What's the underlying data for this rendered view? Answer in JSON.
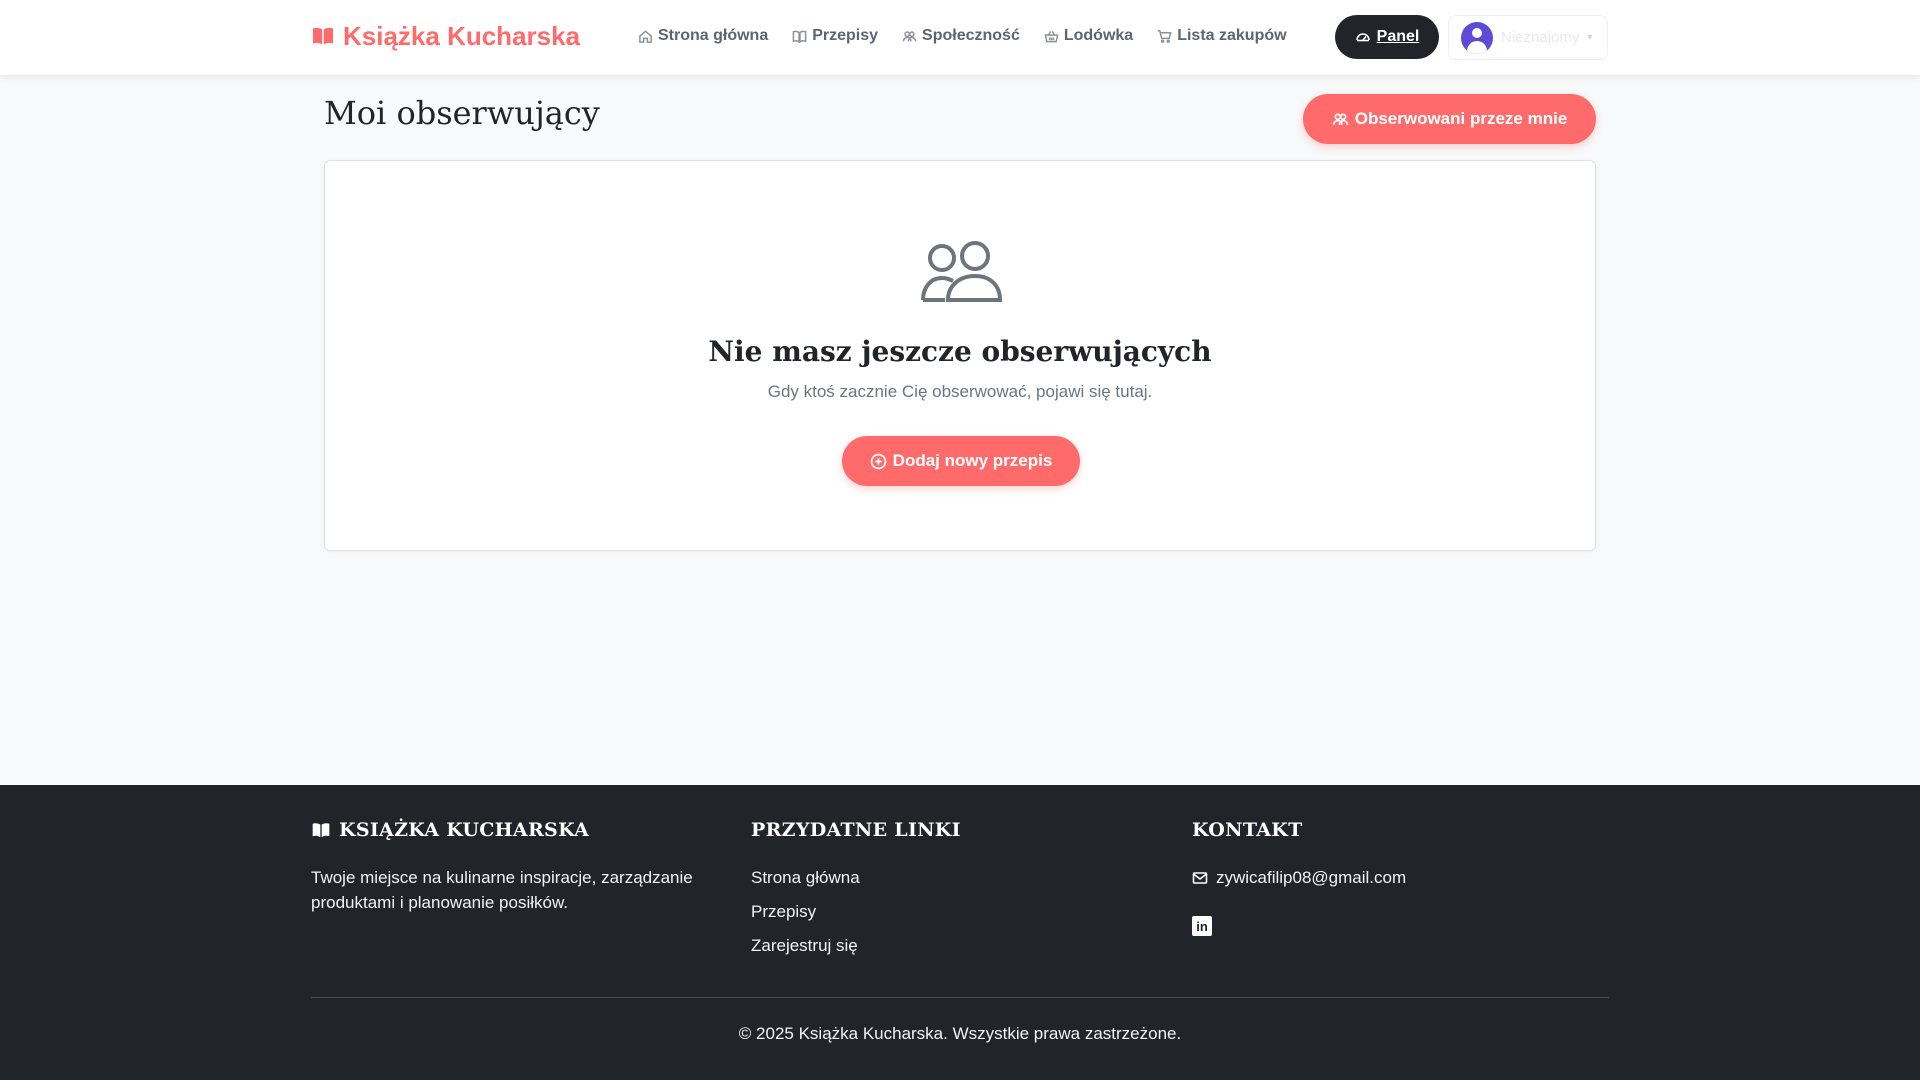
{
  "navbar": {
    "brand": "Książka Kucharska",
    "links": [
      {
        "label": "Strona główna",
        "icon": "home-icon"
      },
      {
        "label": "Przepisy",
        "icon": "book-icon"
      },
      {
        "label": "Społeczność",
        "icon": "people-icon"
      },
      {
        "label": "Lodówka",
        "icon": "basket-icon"
      },
      {
        "label": "Lista zakupów",
        "icon": "cart-icon"
      }
    ],
    "panel_label": "Panel",
    "user_name": "Nieznajomy"
  },
  "page": {
    "title": "Moi obserwujący",
    "following_button": "Obserwowani przeze mnie"
  },
  "empty_state": {
    "title": "Nie masz jeszcze obserwujących",
    "subtitle": "Gdy ktoś zacznie Cię obserwować, pojawi się tutaj.",
    "button": "Dodaj nowy przepis"
  },
  "footer": {
    "brand_heading": "KSIĄŻKA KUCHARSKA",
    "brand_text": "Twoje miejsce na kulinarne inspiracje, zarządzanie produktami i planowanie posiłków.",
    "links_heading": "PRZYDATNE LINKI",
    "links": [
      "Strona główna",
      "Przepisy",
      "Zarejestruj się"
    ],
    "contact_heading": "KONTAKT",
    "email": "zywicafilip08@gmail.com",
    "linkedin_label": "in",
    "copyright": "© 2025 Książka Kucharska. Wszystkie prawa zastrzeżone."
  },
  "colors": {
    "accent": "#ff6b6b",
    "dark": "#212529",
    "background": "#f8f9fa"
  }
}
